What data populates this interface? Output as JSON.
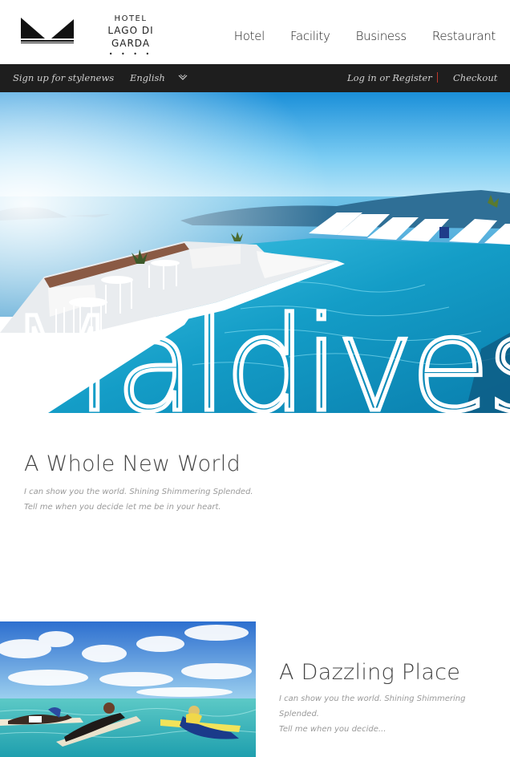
{
  "logo": {
    "hotel": "HOTEL",
    "name": "LAGO DI GARDA",
    "stars": "• • • •"
  },
  "nav": {
    "items": [
      "Hotel",
      "Facility",
      "Business",
      "Restaurant"
    ]
  },
  "topbar": {
    "signup": "Sign up for stylenews",
    "language": "English",
    "login": "Log in or Register",
    "checkout": "Checkout"
  },
  "hero": {
    "headline": "Maldives"
  },
  "intro": {
    "title": "A Whole New World",
    "line1": "I can show you the world. Shining Shimmering Splended.",
    "line2": "Tell me when you decide let me be in your heart."
  },
  "feature": {
    "title": "A Dazzling Place",
    "line1": "I can show you the world. Shining Shimmering",
    "line2": "Splended.",
    "line3": "Tell me when you decide..."
  },
  "colors": {
    "topbar_bg": "#1e1e1e",
    "separator": "#c0392b",
    "pool": "#1fa3c9",
    "sky": "#5ec3f0"
  }
}
